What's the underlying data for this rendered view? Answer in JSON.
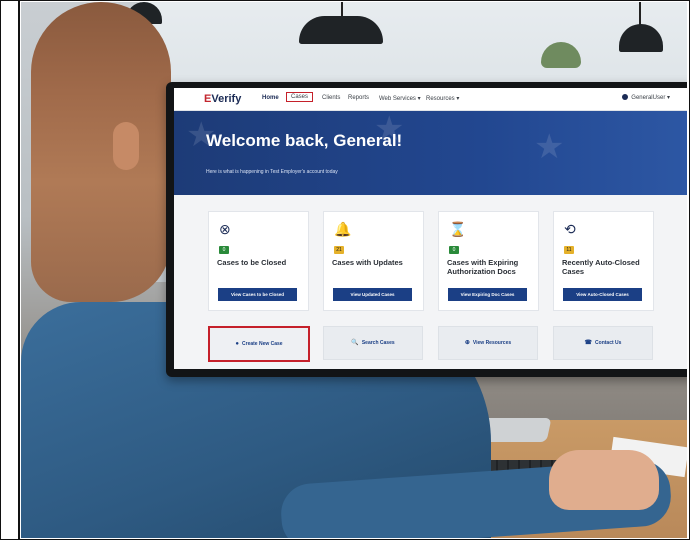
{
  "nav": {
    "logo_prefix": "E",
    "logo_text": "Verify",
    "home": "Home",
    "cases": "Cases",
    "clients": "Clients",
    "reports": "Reports",
    "web_services": "Web Services ▾",
    "resources": "Resources ▾",
    "user": "GeneralUser ▾"
  },
  "hero": {
    "title": "Welcome back, General!",
    "subtitle": "Here is what is happening in Test Employer's account today"
  },
  "cards": [
    {
      "icon": "⊗",
      "badge": "0",
      "badge_color": "#2a8a3a",
      "title": "Cases to be Closed",
      "button": "View Cases to be Closed"
    },
    {
      "icon": "🔔",
      "badge": "21",
      "badge_color": "#e5b12a",
      "title": "Cases with Updates",
      "button": "View Updated Cases"
    },
    {
      "icon": "⌛",
      "badge": "0",
      "badge_color": "#2a8a3a",
      "title": "Cases with Expiring Authorization Docs",
      "button": "View Expiring Doc Cases"
    },
    {
      "icon": "⟲",
      "badge": "11",
      "badge_color": "#e5b12a",
      "title": "Recently Auto-Closed Cases",
      "button": "View Auto-Closed Cases"
    }
  ],
  "actions": [
    {
      "icon": "●",
      "label": "Create New Case"
    },
    {
      "icon": "🔍",
      "label": "Search Cases"
    },
    {
      "icon": "⊕",
      "label": "View Resources"
    },
    {
      "icon": "☎",
      "label": "Contact Us"
    }
  ]
}
